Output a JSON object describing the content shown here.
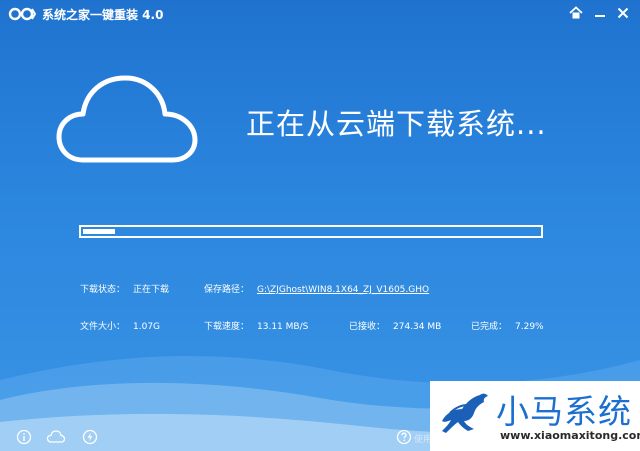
{
  "window": {
    "title": "系统之家一键重装  4.0",
    "controls": [
      "home-icon",
      "minimize-icon",
      "close-icon"
    ]
  },
  "main": {
    "status_headline": "正在从云端下载系统...",
    "progress": 0.07
  },
  "info": {
    "download_status_label": "下载状态：",
    "download_status_value": "正在下载",
    "save_path_label": "保存路径：",
    "save_path_value": "G:\\ZJGhost\\WIN8.1X64_ZJ_V1605.GHO",
    "file_size_label": "文件大小：",
    "file_size_value": "1.07G",
    "speed_label": "下载速度：",
    "speed_value": "13.11 MB/S",
    "received_label": "已接收：",
    "received_value": "274.34 MB",
    "completed_label": "已完成：",
    "completed_value": "7.29%"
  },
  "footer": {
    "icons": [
      "info-icon",
      "cloud-icon",
      "lightning-icon",
      "help-icon"
    ],
    "help_text": "使用"
  },
  "watermark": {
    "name": "小马系统",
    "url": "www.xiaomaxitong.com"
  },
  "colors": {
    "background": "#2b86de",
    "accent": "#ffffff",
    "brand_blue": "#1a6fd0"
  }
}
